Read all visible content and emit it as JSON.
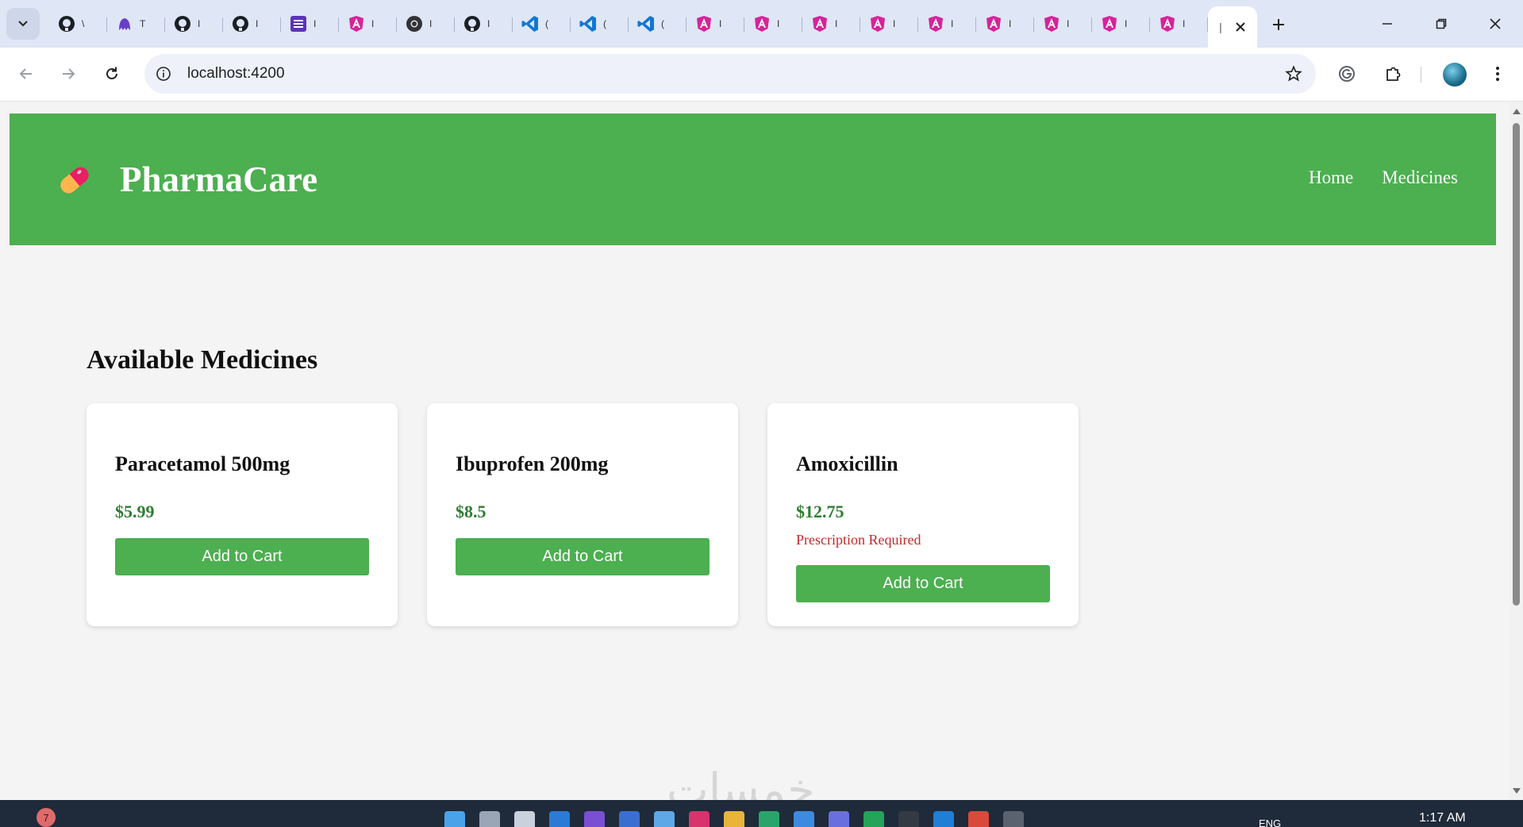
{
  "browser": {
    "url": "localhost:4200",
    "tab_count": 20
  },
  "app": {
    "brand": "PharmaCare",
    "nav": [
      "Home",
      "Medicines"
    ]
  },
  "section": {
    "title": "Available Medicines"
  },
  "products": [
    {
      "name": "Paracetamol 500mg",
      "price": "$5.99",
      "note": "",
      "button": "Add to Cart"
    },
    {
      "name": "Ibuprofen 200mg",
      "price": "$8.5",
      "note": "",
      "button": "Add to Cart"
    },
    {
      "name": "Amoxicillin",
      "price": "$12.75",
      "note": "Prescription Required",
      "button": "Add to Cart"
    }
  ],
  "taskbar": {
    "badge": "7",
    "lang": "ENG",
    "time": "1:17 AM"
  },
  "colors": {
    "header_green": "#4caf50",
    "price_green": "#2e7d32",
    "warning_red": "#c62828"
  }
}
